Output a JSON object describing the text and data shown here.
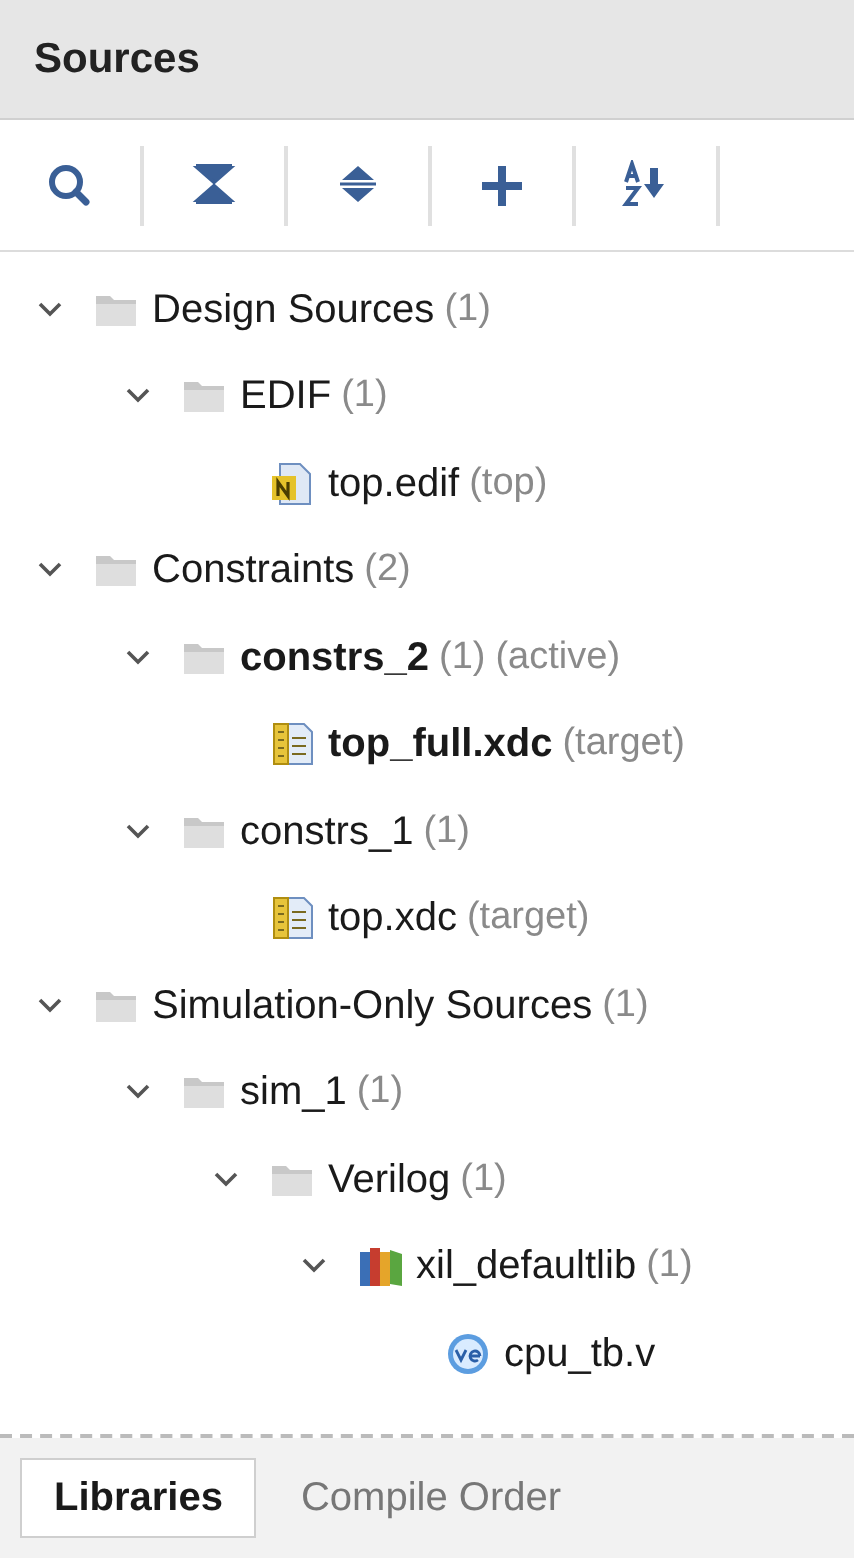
{
  "panel": {
    "title": "Sources"
  },
  "toolbar": [
    {
      "kind": "search"
    },
    {
      "kind": "collapse"
    },
    {
      "kind": "expand"
    },
    {
      "kind": "add"
    },
    {
      "kind": "sort"
    }
  ],
  "tree": [
    {
      "name": "Design Sources",
      "count": "(1)",
      "kind": "folder",
      "expanded": true,
      "children": [
        {
          "name": "EDIF",
          "count": "(1)",
          "kind": "folder",
          "expanded": true,
          "children": [
            {
              "name": "top.edif",
              "note": "(top)",
              "kind": "edif"
            }
          ]
        }
      ]
    },
    {
      "name": "Constraints",
      "count": "(2)",
      "kind": "folder",
      "expanded": true,
      "children": [
        {
          "name": "constrs_2",
          "count": "(1)",
          "note": "(active)",
          "bold": true,
          "kind": "folder",
          "expanded": true,
          "children": [
            {
              "name": "top_full.xdc",
              "note": "(target)",
              "bold": true,
              "kind": "xdc"
            }
          ]
        },
        {
          "name": "constrs_1",
          "count": "(1)",
          "kind": "folder",
          "expanded": true,
          "children": [
            {
              "name": "top.xdc",
              "note": "(target)",
              "kind": "xdc"
            }
          ]
        }
      ]
    },
    {
      "name": "Simulation-Only Sources",
      "count": "(1)",
      "kind": "folder",
      "expanded": true,
      "children": [
        {
          "name": "sim_1",
          "count": "(1)",
          "kind": "folder",
          "expanded": true,
          "children": [
            {
              "name": "Verilog",
              "count": "(1)",
              "kind": "folder",
              "expanded": true,
              "children": [
                {
                  "name": "xil_defaultlib",
                  "count": "(1)",
                  "kind": "library",
                  "expanded": true,
                  "children": [
                    {
                      "name": "cpu_tb.v",
                      "kind": "verilog"
                    }
                  ]
                }
              ]
            }
          ]
        }
      ]
    }
  ],
  "tabs": [
    {
      "label": "Libraries",
      "selected": true
    },
    {
      "label": "Compile Order",
      "selected": false
    }
  ]
}
